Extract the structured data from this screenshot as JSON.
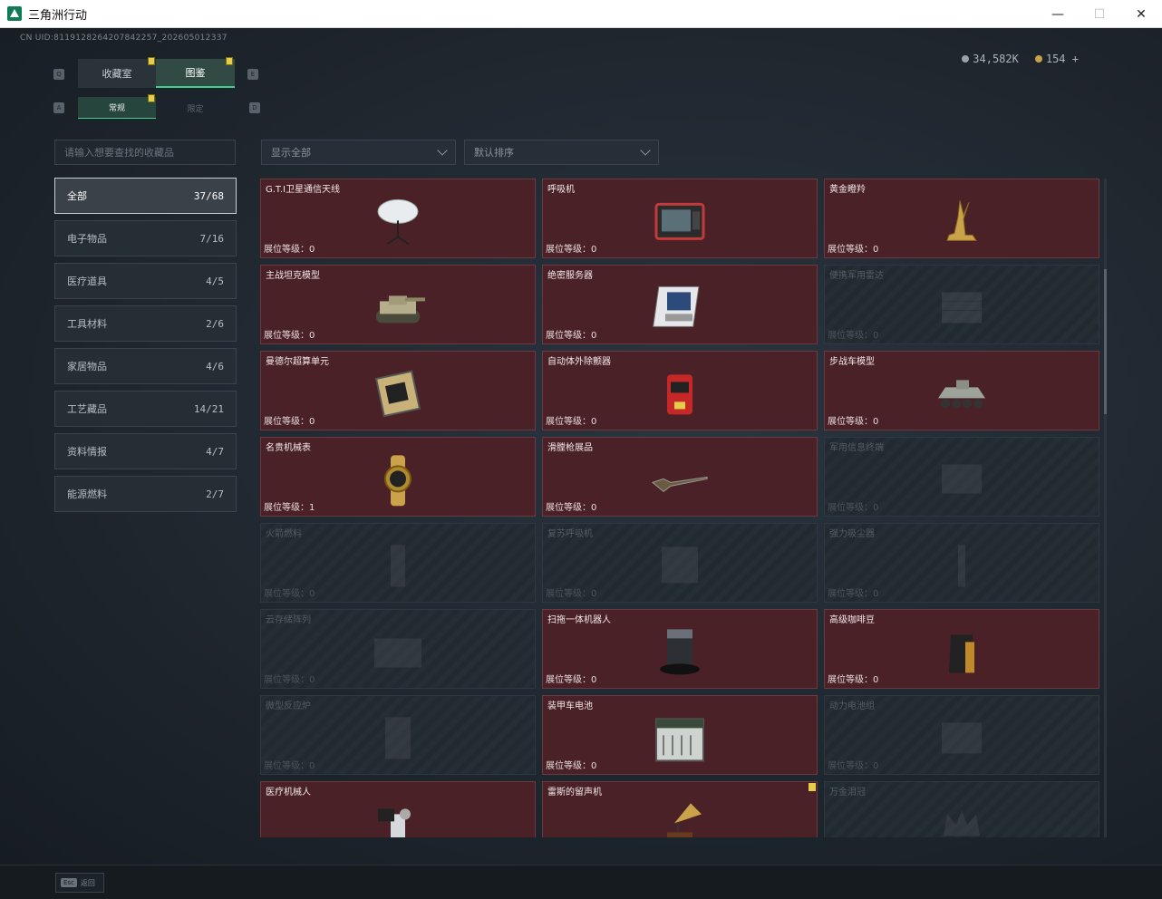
{
  "window": {
    "title": "三角洲行动",
    "minimize": "—",
    "maximize": "☐",
    "close": "✕"
  },
  "uid": "CN UID:8119128264207842257_202605012337",
  "tabs": {
    "collection": "收藏室",
    "catalog": "图鉴",
    "left_key": "Q",
    "right_key": "E"
  },
  "subtabs": {
    "regular": "常规",
    "limited": "限定",
    "left_key": "A",
    "right_key": "D"
  },
  "currency": {
    "silver": "34,582K",
    "gold": "154",
    "add": "+"
  },
  "search": {
    "placeholder": "请输入想要查找的收藏品"
  },
  "filter": {
    "display": "显示全部",
    "sort": "默认排序"
  },
  "categories": [
    {
      "label": "全部",
      "count": "37/68",
      "active": true
    },
    {
      "label": "电子物品",
      "count": "7/16"
    },
    {
      "label": "医疗道具",
      "count": "4/5"
    },
    {
      "label": "工具材料",
      "count": "2/6"
    },
    {
      "label": "家居物品",
      "count": "4/6"
    },
    {
      "label": "工艺藏品",
      "count": "14/21"
    },
    {
      "label": "资料情报",
      "count": "4/7"
    },
    {
      "label": "能源燃料",
      "count": "2/7"
    }
  ],
  "level_prefix": "展位等级：",
  "items": [
    {
      "name": "G.T.I卫星通信天线",
      "level": "0",
      "unlocked": true,
      "icon": "satellite-dish-icon"
    },
    {
      "name": "呼吸机",
      "level": "0",
      "unlocked": true,
      "icon": "ventilator-icon"
    },
    {
      "name": "黄金瞪羚",
      "level": "0",
      "unlocked": true,
      "icon": "gold-gazelle-icon"
    },
    {
      "name": "主战坦克模型",
      "level": "0",
      "unlocked": true,
      "icon": "tank-model-icon"
    },
    {
      "name": "绝密服务器",
      "level": "0",
      "unlocked": true,
      "icon": "server-icon"
    },
    {
      "name": "便携军用雷达",
      "level": "0",
      "unlocked": false,
      "icon": "radar-icon"
    },
    {
      "name": "曼德尔超算单元",
      "level": "0",
      "unlocked": true,
      "icon": "supercomputer-unit-icon"
    },
    {
      "name": "自动体外除颤器",
      "level": "0",
      "unlocked": true,
      "icon": "defibrillator-icon"
    },
    {
      "name": "步战车模型",
      "level": "0",
      "unlocked": true,
      "icon": "ifv-model-icon"
    },
    {
      "name": "名贵机械表",
      "level": "1",
      "unlocked": true,
      "icon": "watch-icon"
    },
    {
      "name": "滑膛枪展品",
      "level": "0",
      "unlocked": true,
      "icon": "musket-icon"
    },
    {
      "name": "军用信息终端",
      "level": "0",
      "unlocked": false,
      "icon": "terminal-icon"
    },
    {
      "name": "火箭燃料",
      "level": "0",
      "unlocked": false,
      "icon": "rocket-fuel-icon"
    },
    {
      "name": "复苏呼吸机",
      "level": "0",
      "unlocked": false,
      "icon": "resuscitator-icon"
    },
    {
      "name": "强力吸尘器",
      "level": "0",
      "unlocked": false,
      "icon": "vacuum-icon"
    },
    {
      "name": "云存储阵列",
      "level": "0",
      "unlocked": false,
      "icon": "storage-array-icon"
    },
    {
      "name": "扫拖一体机器人",
      "level": "0",
      "unlocked": true,
      "icon": "robot-vacuum-icon"
    },
    {
      "name": "高级咖啡豆",
      "level": "0",
      "unlocked": true,
      "icon": "coffee-bag-icon"
    },
    {
      "name": "微型反应炉",
      "level": "0",
      "unlocked": false,
      "icon": "micro-reactor-icon"
    },
    {
      "name": "装甲车电池",
      "level": "0",
      "unlocked": true,
      "icon": "battery-icon"
    },
    {
      "name": "动力电池组",
      "level": "0",
      "unlocked": false,
      "icon": "battery-pack-icon"
    },
    {
      "name": "医疗机械人",
      "level": "",
      "unlocked": true,
      "icon": "medical-robot-icon"
    },
    {
      "name": "雷斯的留声机",
      "level": "",
      "unlocked": true,
      "icon": "gramophone-icon",
      "badge": true
    },
    {
      "name": "万金泪冠",
      "level": "",
      "unlocked": false,
      "icon": "crown-icon"
    }
  ],
  "footer": {
    "esc_key": "Esc",
    "esc_label": "返回"
  },
  "colors": {
    "accent": "#3fd18c",
    "card_unlocked": "#4a2127",
    "badge": "#e6cd4a"
  }
}
